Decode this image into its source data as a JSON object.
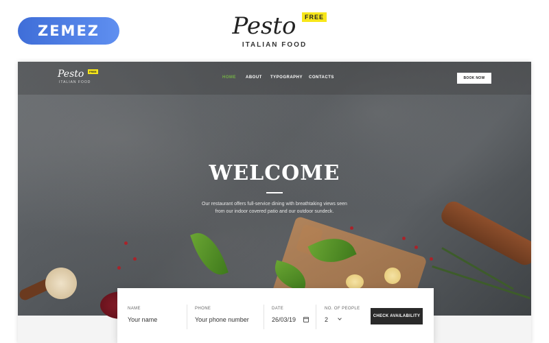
{
  "promo": {
    "vendor_logo": "ZEMEZ",
    "brand_name": "Pesto",
    "brand_badge": "FREE",
    "brand_tagline": "ITALIAN FOOD"
  },
  "site": {
    "logo_name": "Pesto",
    "logo_badge": "FREE",
    "logo_tagline": "ITALIAN FOOD",
    "nav": {
      "home": "HOME",
      "about": "ABOUT",
      "typography": "TYPOGRAPHY",
      "contacts": "CONTACTS"
    },
    "book_button": "BOOK NOW",
    "hero": {
      "title": "WELCOME",
      "text": "Our restaurant offers full-service dining with breathtaking views seen from our indoor covered patio and our outdoor sundeck."
    },
    "booking": {
      "name_label": "NAME",
      "name_placeholder": "Your name",
      "phone_label": "PHONE",
      "phone_placeholder": "Your phone number",
      "date_label": "DATE",
      "date_value": "26/03/19",
      "people_label": "NO. OF PEOPLE",
      "people_value": "2",
      "submit": "CHECK AVAILABILITY"
    }
  },
  "colors": {
    "vendor_gradient": [
      "#3f6ed8",
      "#5f8ff0"
    ],
    "badge": "#f7e61a",
    "nav_active": "#74b046",
    "submit_bg": "#2a2a2a"
  }
}
